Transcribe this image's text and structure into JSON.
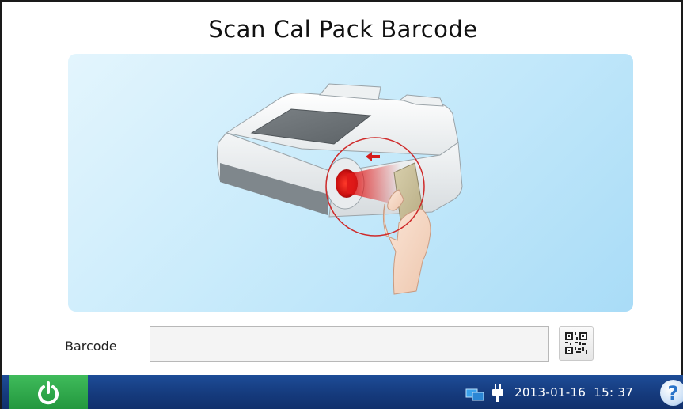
{
  "page": {
    "title": "Scan Cal Pack Barcode"
  },
  "form": {
    "barcode_label": "Barcode",
    "barcode_value": "",
    "barcode_placeholder": ""
  },
  "toolbar": {
    "scan_button_icon": "qr-code-icon"
  },
  "taskbar": {
    "power_icon": "power-icon",
    "network_icon": "network-icon",
    "plug_icon": "power-plug-icon",
    "datetime": "2013-01-16  15: 37",
    "help_label": "?"
  },
  "illustration": {
    "description_icon": "analyzer-scanning-illustration"
  },
  "colors": {
    "taskbar": "#153a7c",
    "power_button": "#2fa84b",
    "illustration_bg": "#c9ebfb",
    "laser": "#e02020"
  }
}
